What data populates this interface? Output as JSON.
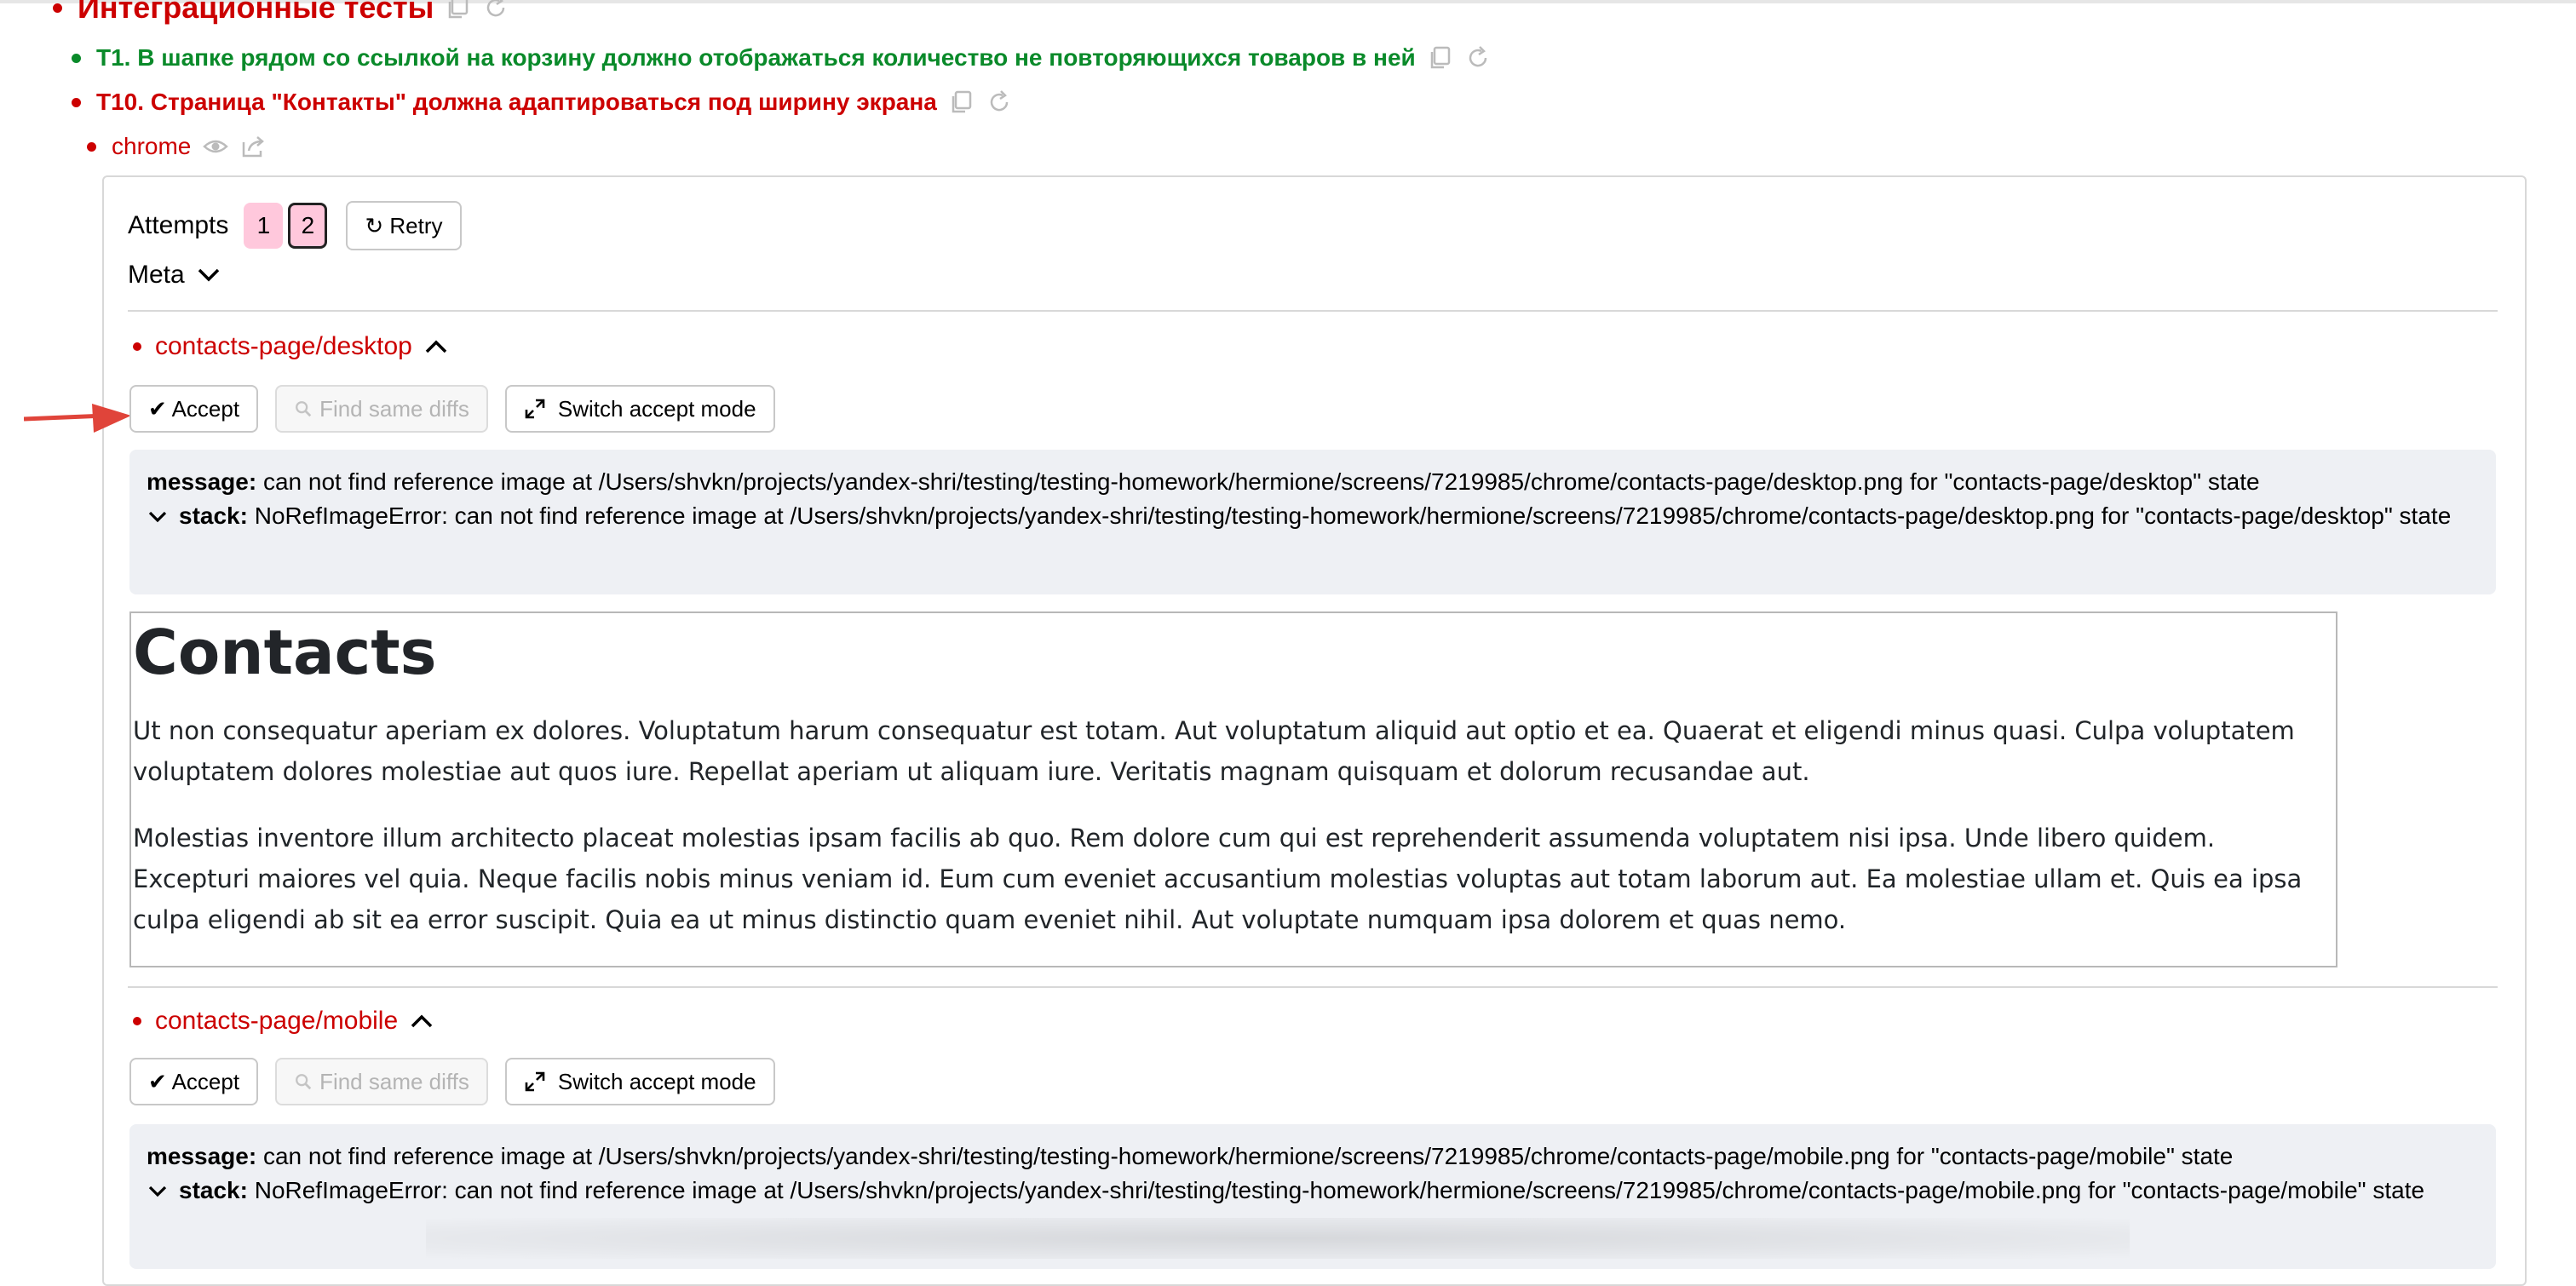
{
  "tree": {
    "suite": "Интеграционные тесты",
    "test_t1": "Т1. В шапке рядом со ссылкой на корзину должно отображаться количество не повторяющихся товаров в ней",
    "test_t10": "Т10. Страница \"Контакты\" должна адаптироваться под ширину экрана",
    "browser": "chrome"
  },
  "attempts": {
    "label": "Attempts",
    "items": [
      "1",
      "2"
    ],
    "active": "2",
    "retry_label": "↻ Retry"
  },
  "meta_label": "Meta",
  "states": [
    {
      "name": "contacts-page/desktop",
      "accept_label": "✔ Accept",
      "find_label": "Find same diffs",
      "switch_label": "Switch accept mode",
      "message_key": "message:",
      "message": "can not find reference image at /Users/shvkn/projects/yandex-shri/testing/testing-homework/hermione/screens/7219985/chrome/contacts-page/desktop.png for \"contacts-page/desktop\" state",
      "stack_key": "stack:",
      "stack": "NoRefImageError: can not find reference image at /Users/shvkn/projects/yandex-shri/testing/testing-homework/hermione/screens/7219985/chrome/contacts-page/desktop.png for \"contacts-page/desktop\" state"
    },
    {
      "name": "contacts-page/mobile",
      "accept_label": "✔ Accept",
      "find_label": "Find same diffs",
      "switch_label": "Switch accept mode",
      "message_key": "message:",
      "message": "can not find reference image at /Users/shvkn/projects/yandex-shri/testing/testing-homework/hermione/screens/7219985/chrome/contacts-page/mobile.png for \"contacts-page/mobile\" state",
      "stack_key": "stack:",
      "stack": "NoRefImageError: can not find reference image at /Users/shvkn/projects/yandex-shri/testing/testing-homework/hermione/screens/7219985/chrome/contacts-page/mobile.png for \"contacts-page/mobile\" state"
    }
  ],
  "screenshot": {
    "title": "Contacts",
    "paragraph1": "Ut non consequatur aperiam ex dolores. Voluptatum harum consequatur est totam. Aut voluptatum aliquid aut optio et ea. Quaerat et eligendi minus quasi. Culpa voluptatem voluptatem dolores molestiae aut quos iure. Repellat aperiam ut aliquam iure. Veritatis magnam quisquam et dolorum recusandae aut.",
    "paragraph2": "Molestias inventore illum architecto placeat molestias ipsam facilis ab quo. Rem dolore cum qui est reprehenderit assumenda voluptatem nisi ipsa. Unde libero quidem. Excepturi maiores vel quia. Neque facilis nobis minus veniam id. Eum cum eveniet accusantium molestias voluptas aut totam laborum aut. Ea molestiae ullam et. Quis ea ipsa culpa eligendi ab sit ea error suscipit. Quia ea ut minus distinctio quam eveniet nihil. Aut voluptate numquam ipsa dolorem et quas nemo."
  },
  "colors": {
    "fail": "#cc0000",
    "success": "#0a8a2a",
    "attempt_bg": "#ffc8dc",
    "error_bg": "#eef0f4",
    "arrow": "#e0443a"
  },
  "icons": [
    "copy-icon",
    "retry-icon",
    "eye-icon",
    "share-icon",
    "search-icon",
    "expand-icon",
    "chevron-down-icon",
    "chevron-up-icon",
    "arrow-icon"
  ]
}
